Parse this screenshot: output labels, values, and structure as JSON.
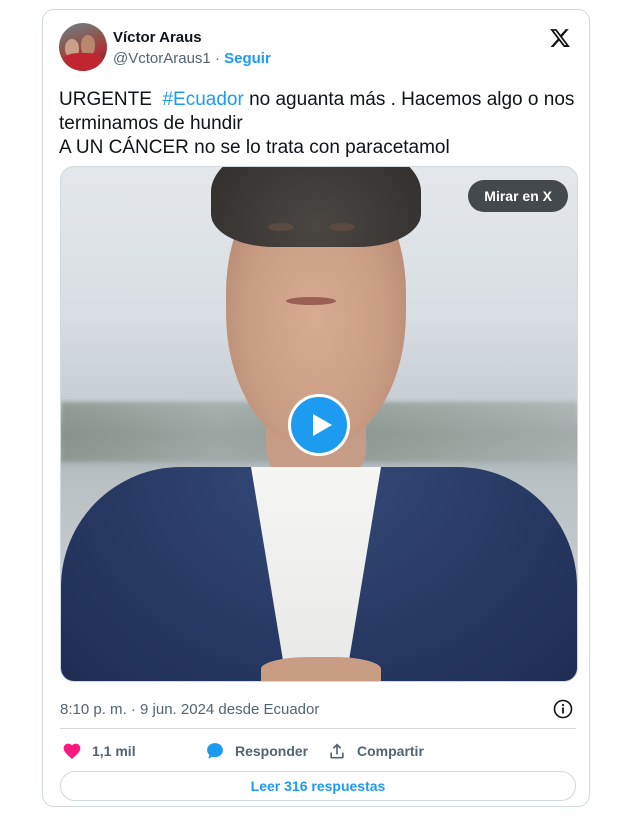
{
  "author": {
    "name": "Víctor Araus",
    "handle": "@VctorAraus1",
    "separator": "·",
    "follow_label": "Seguir"
  },
  "tweet": {
    "text_part1": "URGENTE  ",
    "hashtag": "#Ecuador",
    "text_part2": " no aguanta más . Hacemos algo o nos terminamos de hundir",
    "line2": "A UN CÁNCER no se lo trata con paracetamol"
  },
  "media": {
    "watch_label": "Mirar en X"
  },
  "meta": {
    "timestamp": "8:10 p. m. · 9 jun. 2024 desde Ecuador"
  },
  "actions": {
    "likes": "1,1 mil",
    "reply_label": "Responder",
    "share_label": "Compartir"
  },
  "replies_link": "Leer 316 respuestas",
  "colors": {
    "accent": "#1d9bf0",
    "like": "#f91880",
    "text": "#0f1419",
    "muted": "#536471",
    "border": "#cfd9de"
  },
  "icons": [
    "x-logo-icon",
    "info-icon",
    "heart-icon",
    "comment-icon",
    "share-icon",
    "play-icon"
  ]
}
